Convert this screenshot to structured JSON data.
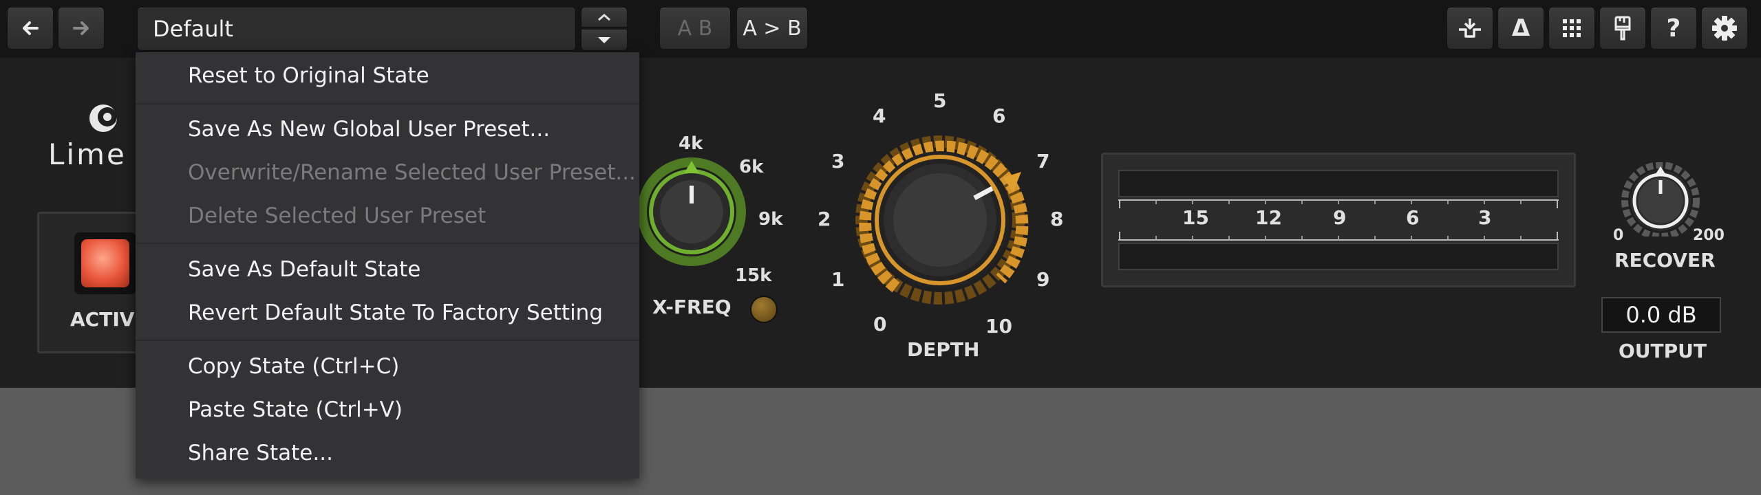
{
  "toolbar": {
    "preset_name": "Default",
    "ab_label": "A B",
    "ab_copy_label": "A > B",
    "nav_back_icon": "arrow-left-icon",
    "nav_forward_icon": "arrow-right-icon",
    "right_icons": [
      "routing-icon",
      "delta-icon",
      "grid-icon",
      "skin-icon",
      "help-icon",
      "gear-icon"
    ],
    "help_glyph": "?",
    "delta_glyph": "Δ"
  },
  "menu": {
    "items": [
      {
        "label": "Reset to Original State",
        "enabled": true
      },
      {
        "label": "Save As New Global User Preset...",
        "enabled": true
      },
      {
        "label": "Overwrite/Rename Selected User Preset...",
        "enabled": false
      },
      {
        "label": "Delete Selected User Preset",
        "enabled": false
      },
      {
        "label": "Save As Default State",
        "enabled": true
      },
      {
        "label": "Revert Default State To Factory Setting",
        "enabled": true
      },
      {
        "label": "Copy State (Ctrl+C)",
        "enabled": true
      },
      {
        "label": "Paste State (Ctrl+V)",
        "enabled": true
      },
      {
        "label": "Share State...",
        "enabled": true
      }
    ]
  },
  "plugin": {
    "brand": "Lime",
    "active_label": "ACTIVE",
    "xfreq": {
      "label": "X-FREQ",
      "ticks": [
        "4k",
        "6k",
        "9k",
        "15k"
      ]
    },
    "depth": {
      "label": "DEPTH",
      "ticks": [
        "0",
        "1",
        "2",
        "3",
        "4",
        "5",
        "6",
        "7",
        "8",
        "9",
        "10"
      ],
      "value": 7.2
    },
    "meter": {
      "scale": [
        "15",
        "12",
        "9",
        "6",
        "3"
      ]
    },
    "recover": {
      "label": "RECOVER",
      "min": "0",
      "max": "200"
    },
    "output": {
      "label": "OUTPUT",
      "value": "0.0 dB"
    }
  },
  "colors": {
    "accent_green": "#6fb02e",
    "accent_orange": "#d8962a",
    "active_red": "#e8553a"
  }
}
